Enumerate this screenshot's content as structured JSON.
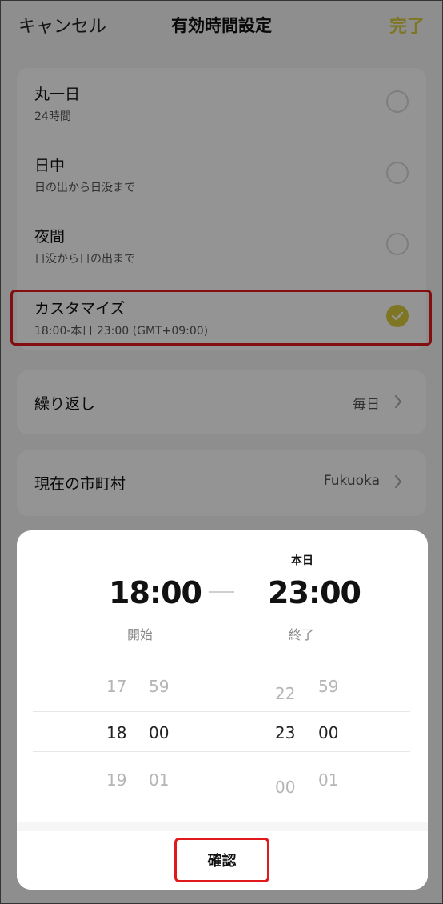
{
  "header": {
    "cancel": "キャンセル",
    "title": "有効時間設定",
    "done": "完了"
  },
  "options": [
    {
      "title": "丸一日",
      "sub": "24時間",
      "checked": false
    },
    {
      "title": "日中",
      "sub": "日の出から日没まで",
      "checked": false
    },
    {
      "title": "夜間",
      "sub": "日没から日の出まで",
      "checked": false
    },
    {
      "title": "カスタマイズ",
      "sub": "18:00-本日 23:00 (GMT+09:00)",
      "checked": true
    }
  ],
  "repeat": {
    "label": "繰り返し",
    "value": "毎日"
  },
  "city": {
    "label": "現在の市町村",
    "value": "Fukuoka"
  },
  "picker": {
    "end_day": "本日",
    "start_time": "18:00",
    "end_time": "23:00",
    "start_label": "開始",
    "end_label": "終了",
    "start_hours": [
      "17",
      "18",
      "19"
    ],
    "start_minutes": [
      "59",
      "00",
      "01"
    ],
    "end_hours": [
      "22",
      "23",
      "00"
    ],
    "end_minutes": [
      "59",
      "00",
      "01"
    ],
    "confirm": "確認"
  },
  "colors": {
    "accent": "#d9cc3c",
    "highlight": "#e0191b"
  }
}
